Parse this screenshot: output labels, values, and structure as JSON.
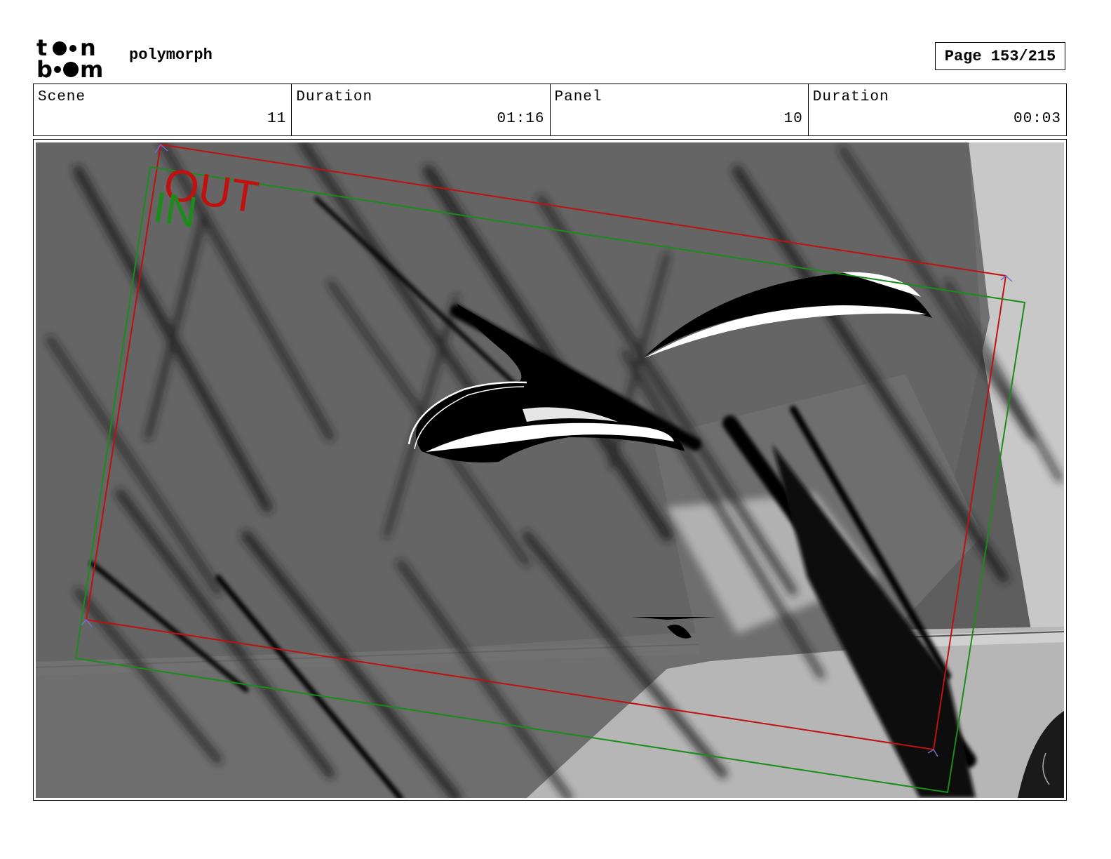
{
  "header": {
    "logo_line1": "toon",
    "logo_line2": "boom",
    "project_name": "polymorph",
    "page_label": "Page 153/215"
  },
  "info": {
    "scene_label": "Scene",
    "scene_value": "11",
    "scene_duration_label": "Duration",
    "scene_duration_value": "01:16",
    "panel_label": "Panel",
    "panel_value": "10",
    "panel_duration_label": "Duration",
    "panel_duration_value": "00:03"
  },
  "camera": {
    "in_label": "IN",
    "out_label": "OUT",
    "in_color": "#1a8c1a",
    "out_color": "#c01010"
  }
}
